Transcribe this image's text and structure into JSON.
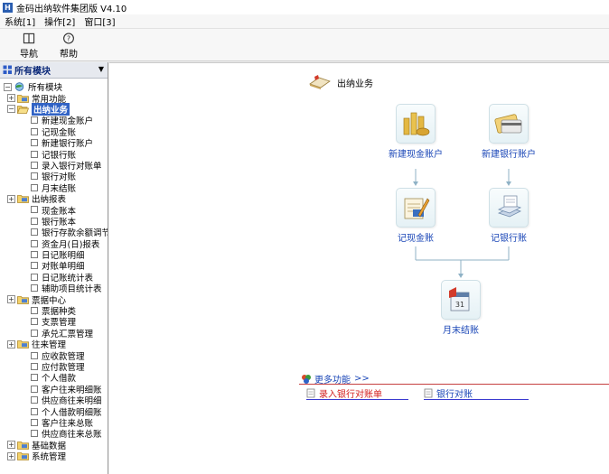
{
  "window": {
    "title": "金码出纳软件集团版 V4.10"
  },
  "menu": [
    "系统[1]",
    "操作[2]",
    "窗口[3]"
  ],
  "toolbar": {
    "nav_label": "导航",
    "help_label": "帮助"
  },
  "sidebar": {
    "header": "所有模块",
    "tree": [
      {
        "text": "所有模块",
        "level": 0,
        "kind": "root"
      },
      {
        "text": "常用功能",
        "level": 1,
        "kind": "folder"
      },
      {
        "text": "出纳业务",
        "level": 1,
        "kind": "folder-open",
        "selected": true
      },
      {
        "text": "新建现金账户",
        "level": 2,
        "kind": "leaf"
      },
      {
        "text": "记现金账",
        "level": 2,
        "kind": "leaf"
      },
      {
        "text": "新建银行账户",
        "level": 2,
        "kind": "leaf"
      },
      {
        "text": "记银行账",
        "level": 2,
        "kind": "leaf"
      },
      {
        "text": "录入银行对账单",
        "level": 2,
        "kind": "leaf"
      },
      {
        "text": "银行对账",
        "level": 2,
        "kind": "leaf"
      },
      {
        "text": "月末结账",
        "level": 2,
        "kind": "leaf"
      },
      {
        "text": "出纳报表",
        "level": 1,
        "kind": "folder"
      },
      {
        "text": "现金账本",
        "level": 2,
        "kind": "leaf"
      },
      {
        "text": "银行账本",
        "level": 2,
        "kind": "leaf"
      },
      {
        "text": "银行存款余额调节",
        "level": 2,
        "kind": "leaf"
      },
      {
        "text": "资金月(日)报表",
        "level": 2,
        "kind": "leaf"
      },
      {
        "text": "日记账明细",
        "level": 2,
        "kind": "leaf"
      },
      {
        "text": "对账单明细",
        "level": 2,
        "kind": "leaf"
      },
      {
        "text": "日记账统计表",
        "level": 2,
        "kind": "leaf"
      },
      {
        "text": "辅助项目统计表",
        "level": 2,
        "kind": "leaf"
      },
      {
        "text": "票据中心",
        "level": 1,
        "kind": "folder"
      },
      {
        "text": "票据种类",
        "level": 2,
        "kind": "leaf"
      },
      {
        "text": "支票管理",
        "level": 2,
        "kind": "leaf"
      },
      {
        "text": "承兑汇票管理",
        "level": 2,
        "kind": "leaf"
      },
      {
        "text": "往来管理",
        "level": 1,
        "kind": "folder"
      },
      {
        "text": "应收款管理",
        "level": 2,
        "kind": "leaf"
      },
      {
        "text": "应付款管理",
        "level": 2,
        "kind": "leaf"
      },
      {
        "text": "个人借款",
        "level": 2,
        "kind": "leaf"
      },
      {
        "text": "客户往来明细账",
        "level": 2,
        "kind": "leaf"
      },
      {
        "text": "供应商往来明细",
        "level": 2,
        "kind": "leaf"
      },
      {
        "text": "个人借款明细账",
        "level": 2,
        "kind": "leaf"
      },
      {
        "text": "客户往来总账",
        "level": 2,
        "kind": "leaf"
      },
      {
        "text": "供应商往来总账",
        "level": 2,
        "kind": "leaf"
      },
      {
        "text": "基础数据",
        "level": 1,
        "kind": "folder"
      },
      {
        "text": "系统管理",
        "level": 1,
        "kind": "folder"
      }
    ]
  },
  "main": {
    "section_title": "出纳业务",
    "nodes": {
      "new_cash": "新建现金账户",
      "new_bank": "新建银行账户",
      "cash_journal": "记现金账",
      "bank_journal": "记银行账",
      "month_close": "月末结账"
    },
    "more": {
      "title": "更多功能",
      "arrow": ">>",
      "links": [
        "录入银行对账单",
        "银行对账"
      ]
    }
  },
  "colors": {
    "accent": "#1a46b7",
    "selection": "#3163c5",
    "link_red": "#d42020",
    "link_blue": "#1a46b7"
  }
}
